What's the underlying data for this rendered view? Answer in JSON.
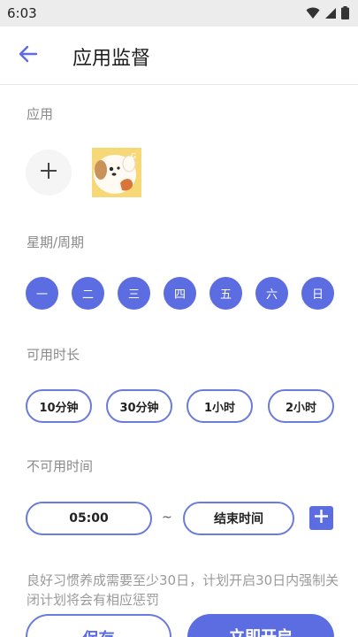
{
  "status_bar": {
    "time": "6:03",
    "icons": [
      "wifi-icon",
      "signal-icon",
      "battery-icon"
    ]
  },
  "app_bar": {
    "back_icon": "arrow-left-icon",
    "title": "应用监督"
  },
  "apps_section": {
    "label": "应用",
    "add_icon": "plus-icon",
    "selected_app": "app-icon-cartoon-dog"
  },
  "week_section": {
    "label": "星期/周期",
    "days": [
      "一",
      "二",
      "三",
      "四",
      "五",
      "六",
      "日"
    ]
  },
  "duration_section": {
    "label": "可用时长",
    "options": [
      "10分钟",
      "30分钟",
      "1小时",
      "2小时"
    ]
  },
  "unavailable_section": {
    "label": "不可用时间",
    "start_value": "05:00",
    "separator": "~",
    "end_placeholder": "结束时间",
    "add_icon": "plus-icon"
  },
  "notice": "良好习惯养成需要至少30日，计划开启30日内强制关闭计划将会有相应惩罚",
  "actions": {
    "save_label": "保存",
    "start_label": "立即开启"
  },
  "colors": {
    "accent": "#5b6de0",
    "accent_border": "#6a7bdc",
    "label_gray": "#8a8a8a"
  }
}
